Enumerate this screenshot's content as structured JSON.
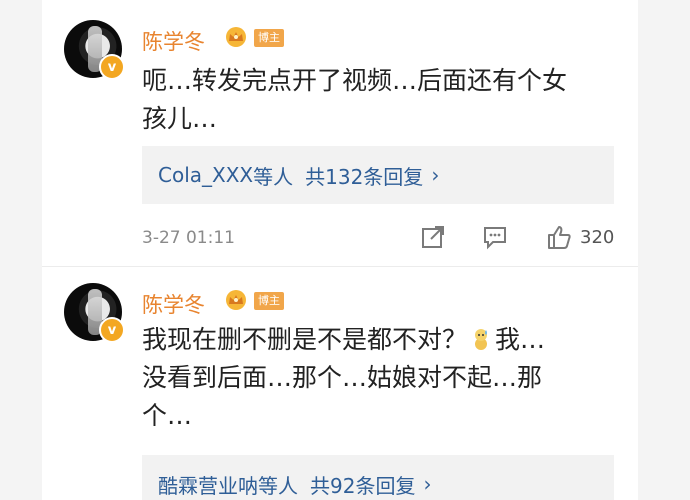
{
  "comments": [
    {
      "username": "陈学冬",
      "badge": "博主",
      "verified_mark": "v",
      "text_lines": [
        "呃…转发完点开了视频…后面还有个女",
        "孩儿…"
      ],
      "replies": {
        "who": "Cola_XXX",
        "suffix": "等人",
        "count": "共132条回复",
        "chevron": "›"
      },
      "time": "3-27 01:11",
      "likes": "320"
    },
    {
      "username": "陈学冬",
      "badge": "博主",
      "verified_mark": "v",
      "text_lines": [
        "我现在删不删是不是都不对？",
        "我…",
        "没看到后面…那个…姑娘对不起…那",
        "个…"
      ],
      "replies": {
        "who": "酷霖营业呐",
        "suffix": "等人",
        "count": "共92条回复",
        "chevron": "›"
      }
    }
  ],
  "icons": {
    "crown": "crown-icon",
    "share": "share-icon",
    "comment": "comment-icon",
    "like": "thumbs-up-icon",
    "emoji": "sweat-emoji-icon"
  },
  "colors": {
    "username": "#e8842f",
    "badge_bg": "#f1a64a",
    "reply_link": "#2f5e97",
    "reply_bg": "#f2f2f2",
    "verified": "#f3a722"
  }
}
